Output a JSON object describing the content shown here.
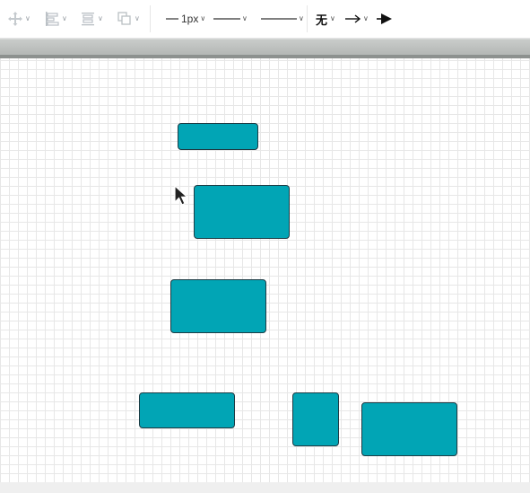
{
  "toolbar": {
    "arrange_icon": "move-arrows-icon",
    "align_icon": "align-left-icon",
    "distribute_icon": "distribute-icon",
    "group_icon": "layers-icon",
    "line_width_label": "1px",
    "line_style_icon": "solid-line-icon",
    "line_dash_icon": "dashed-line-icon",
    "start_arrow_label": "无",
    "end_arrow_icon": "arrow-right-icon",
    "arrow_head_icon": "triangle-arrow-icon"
  },
  "canvas": {
    "shape_fill": "#01a5b5",
    "shape_border": "#1d3b44",
    "shape_count": 6
  }
}
